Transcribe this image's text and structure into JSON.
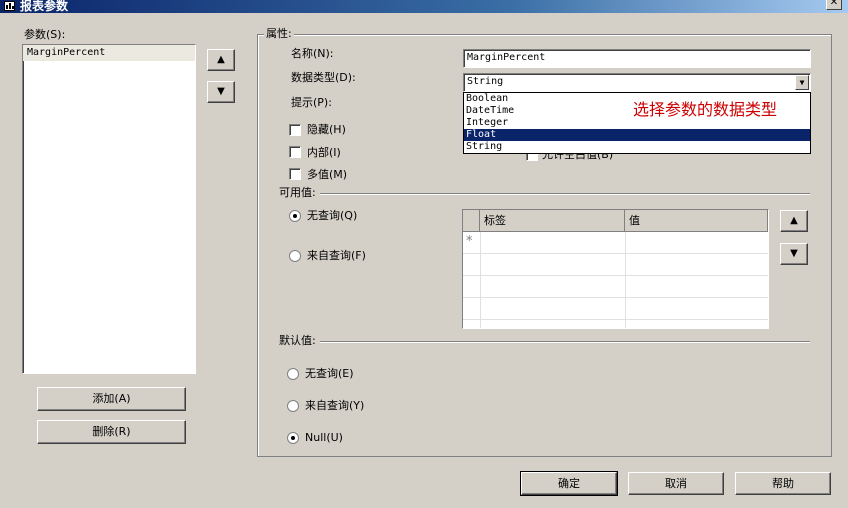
{
  "window": {
    "title": "报表参数",
    "close_glyph": "✕"
  },
  "parameters": {
    "label": "参数(S):",
    "items": [
      "MarginPercent"
    ],
    "move_up_icon": "arrow-up-icon",
    "move_down_icon": "arrow-down-icon",
    "add_label": "添加(A)",
    "delete_label": "删除(R)"
  },
  "properties": {
    "group_label": "属性:",
    "name_label": "名称(N):",
    "name_value": "MarginPercent",
    "datatype_label": "数据类型(D):",
    "datatype_value": "String",
    "prompt_label": "提示(P):",
    "hidden_label": "隐藏(H)",
    "internal_label": "内部(I)",
    "multivalue_label": "多值(M)",
    "allow_blank_partial": "允许空白值(B)",
    "datatype_options": [
      "Boolean",
      "DateTime",
      "Integer",
      "Float",
      "String"
    ],
    "datatype_highlighted": "Float"
  },
  "annotation": {
    "text": "选择参数的数据类型",
    "color": "#cc0000"
  },
  "available_values": {
    "label": "可用值:",
    "option_no_query": "无查询(Q)",
    "option_from_query": "来自查询(F)",
    "selected": "无查询(Q)",
    "grid_columns": [
      "标签",
      "值"
    ],
    "new_row_marker": "*"
  },
  "default_values": {
    "label": "默认值:",
    "option_no_query": "无查询(E)",
    "option_from_query": "来自查询(Y)",
    "option_null": "Null(U)",
    "selected": "Null(U)"
  },
  "footer": {
    "ok_label": "确定",
    "cancel_label": "取消",
    "help_label": "帮助"
  }
}
